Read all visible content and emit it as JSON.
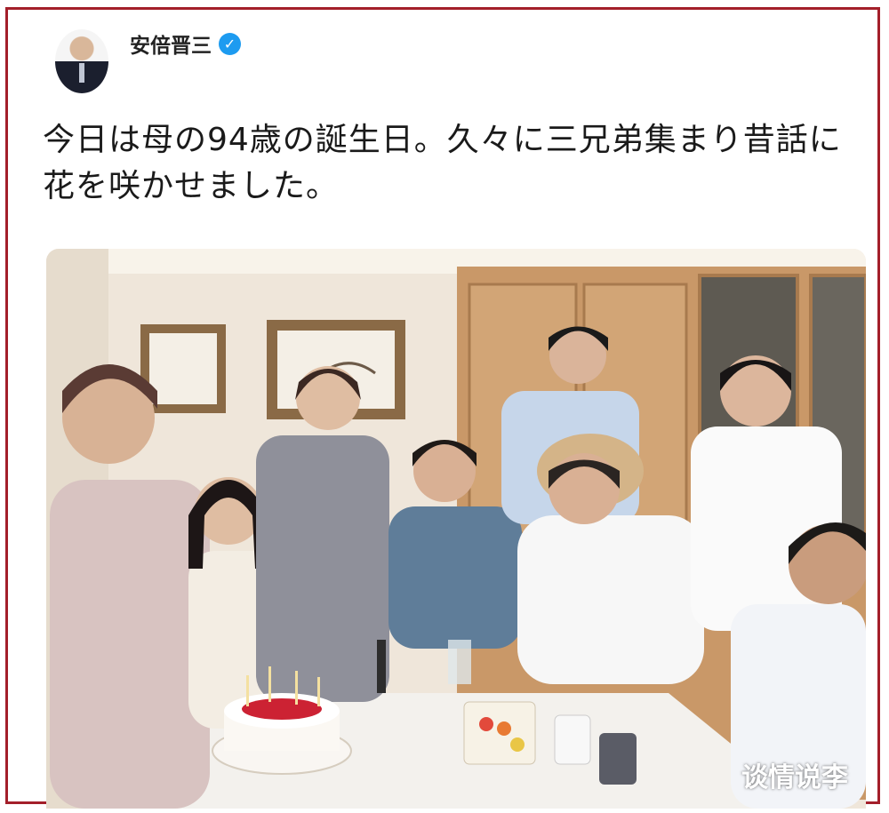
{
  "tweet": {
    "author_name": "安倍晋三",
    "verified_symbol": "✓",
    "text_line1": "今日は母の94歳の誕生日。久々に三兄弟集まり昔話に",
    "text_line2": "花を咲かせました。"
  },
  "watermark": "谈情说李",
  "colors": {
    "frame": "#a31f2a",
    "verified": "#1d9bf0"
  }
}
